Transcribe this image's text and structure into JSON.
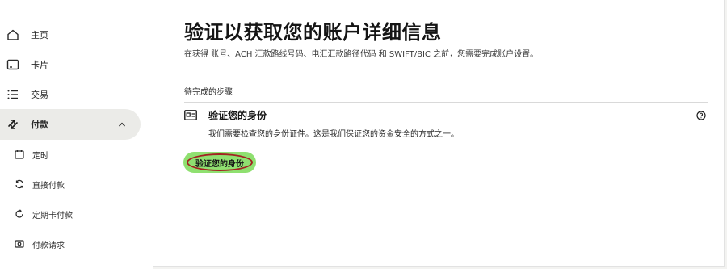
{
  "sidebar": {
    "items": [
      {
        "label": "主页",
        "icon": "home-icon"
      },
      {
        "label": "卡片",
        "icon": "card-icon"
      },
      {
        "label": "交易",
        "icon": "list-icon"
      },
      {
        "label": "付款",
        "icon": "transfer-icon",
        "expanded": true
      }
    ],
    "sub_items": [
      {
        "label": "定时",
        "icon": "calendar-icon"
      },
      {
        "label": "直接付款",
        "icon": "refresh-icon"
      },
      {
        "label": "定期卡付款",
        "icon": "recurring-icon"
      },
      {
        "label": "付款请求",
        "icon": "request-icon"
      }
    ]
  },
  "main": {
    "title": "验证以获取您的账户详细信息",
    "subtitle": "在获得 账号、ACH 汇款路线号码、电汇汇款路径代码 和 SWIFT/BIC 之前，您需要完成账户设置。",
    "section_label": "待完成的步骤",
    "step": {
      "title": "验证您的身份",
      "description": "我们需要检查您的身份证件。这是我们保证您的资金安全的方式之一。",
      "icon": "id-card-icon",
      "help_icon": "help-circle-icon"
    },
    "button_label": "验证您的身份"
  },
  "colors": {
    "accent_button": "#8fe070",
    "annotation_circle": "#a32121",
    "active_nav_bg": "#ebebe8",
    "sidebar_bg": "#ffffff",
    "page_bg": "#f3f3f1"
  }
}
